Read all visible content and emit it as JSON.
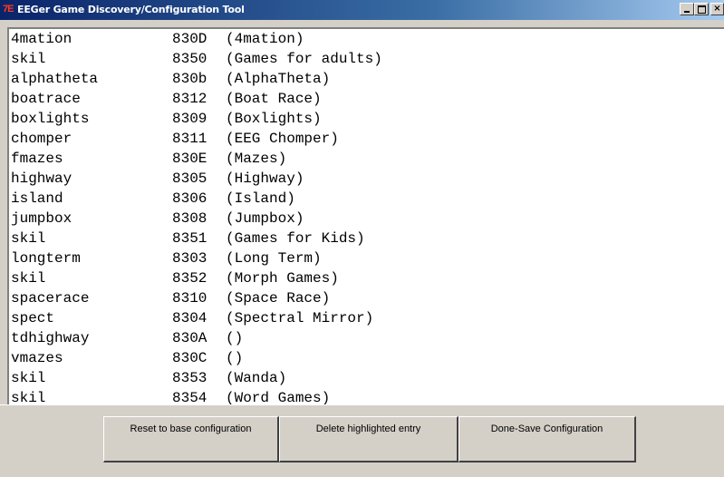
{
  "window": {
    "icon_text": "7Ε",
    "title": "EEGer Game Discovery/Configuration Tool",
    "minimize_label": "_",
    "maximize_label": "□",
    "close_label": "×"
  },
  "list": {
    "items": [
      {
        "name": "4mation",
        "code": "830D",
        "desc": "(4mation)"
      },
      {
        "name": "skil",
        "code": "8350",
        "desc": "(Games for adults)"
      },
      {
        "name": "alphatheta",
        "code": "830b",
        "desc": "(AlphaTheta)"
      },
      {
        "name": "boatrace",
        "code": "8312",
        "desc": "(Boat Race)"
      },
      {
        "name": "boxlights",
        "code": "8309",
        "desc": "(Boxlights)"
      },
      {
        "name": "chomper",
        "code": "8311",
        "desc": "(EEG Chomper)"
      },
      {
        "name": "fmazes",
        "code": "830E",
        "desc": "(Mazes)"
      },
      {
        "name": "highway",
        "code": "8305",
        "desc": "(Highway)"
      },
      {
        "name": "island",
        "code": "8306",
        "desc": "(Island)"
      },
      {
        "name": "jumpbox",
        "code": "8308",
        "desc": "(Jumpbox)"
      },
      {
        "name": "skil",
        "code": "8351",
        "desc": "(Games for Kids)"
      },
      {
        "name": "longterm",
        "code": "8303",
        "desc": "(Long Term)"
      },
      {
        "name": "skil",
        "code": "8352",
        "desc": "(Morph Games)"
      },
      {
        "name": "spacerace",
        "code": "8310",
        "desc": "(Space Race)"
      },
      {
        "name": "spect",
        "code": "8304",
        "desc": "(Spectral Mirror)"
      },
      {
        "name": "tdhighway",
        "code": "830A",
        "desc": "()"
      },
      {
        "name": "vmazes",
        "code": "830C",
        "desc": "()"
      },
      {
        "name": "skil",
        "code": "8353",
        "desc": "(Wanda)"
      },
      {
        "name": "skil",
        "code": "8354",
        "desc": "(Word Games)"
      }
    ]
  },
  "buttons": {
    "reset_label": "Reset to base configuration",
    "delete_label": "Delete highlighted entry",
    "done_label": "Done-Save Configuration"
  }
}
